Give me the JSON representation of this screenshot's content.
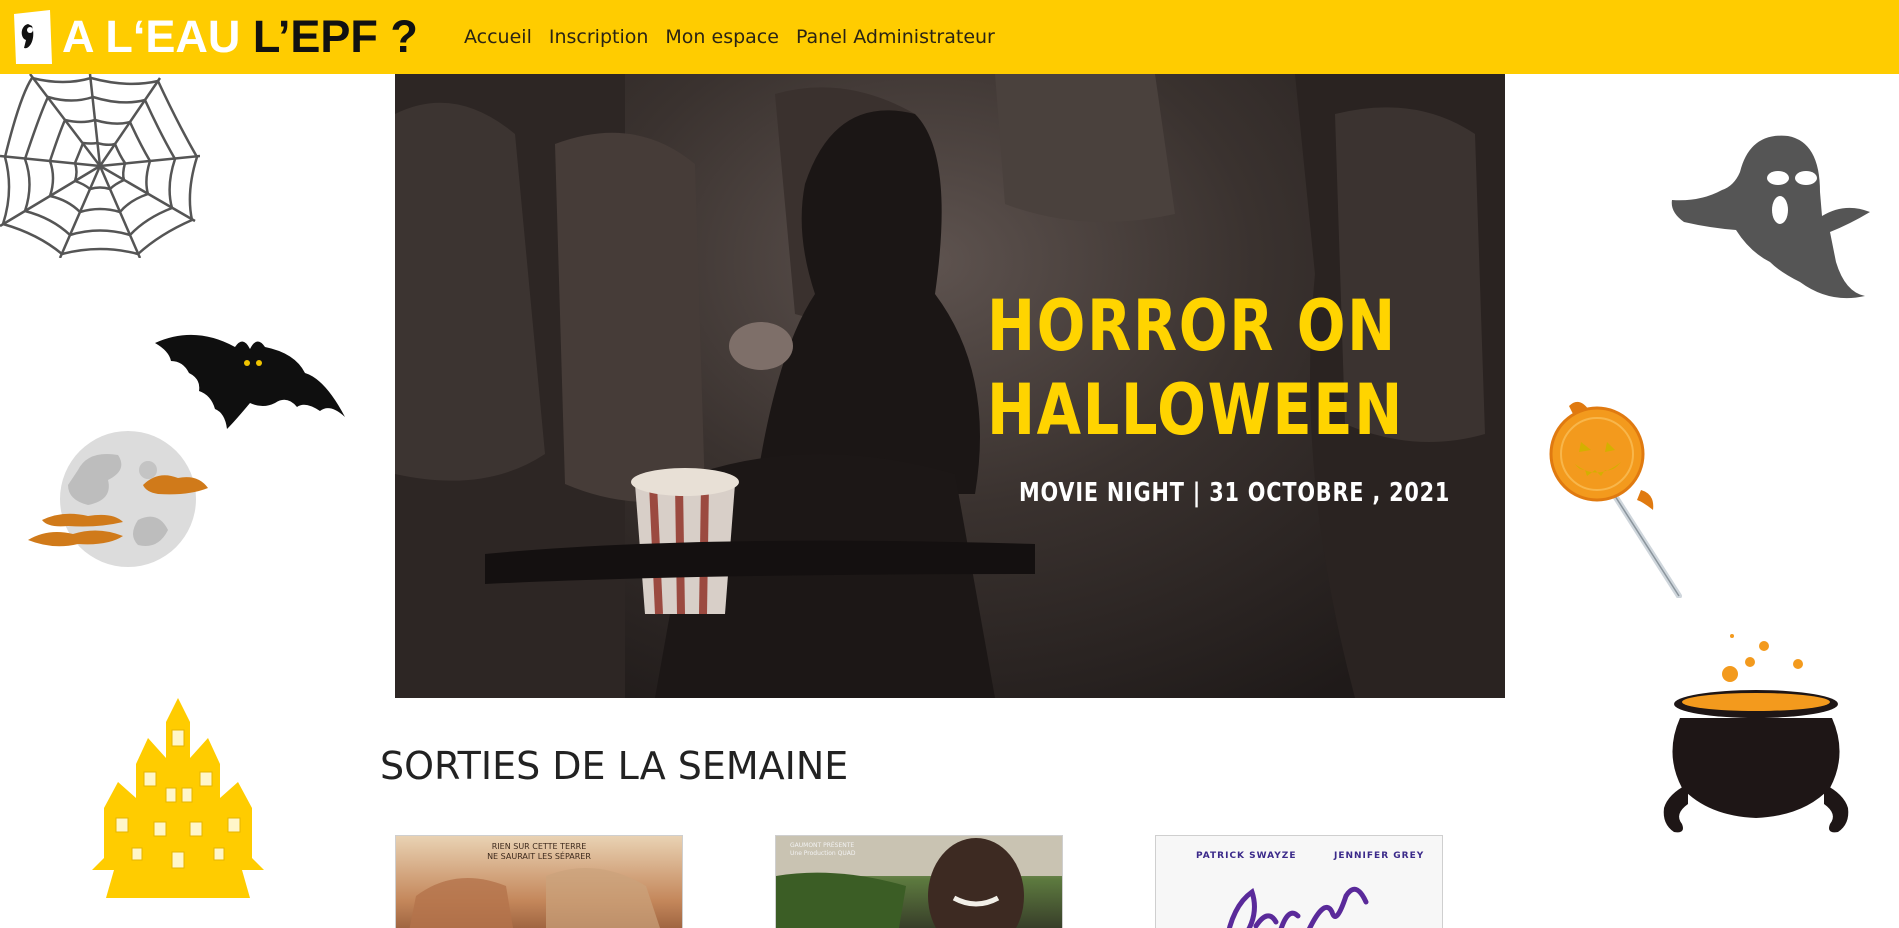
{
  "navbar": {
    "logo": {
      "part1": "A L‘EAU",
      "part2": "L’EPF ?"
    },
    "links": [
      "Accueil",
      "Inscription",
      "Mon espace",
      "Panel Administrateur"
    ]
  },
  "banner": {
    "title_line1": "HORROR ON",
    "title_line2": "HALLOWEEN",
    "subtitle": "MOVIE NIGHT | 31 OCTOBRE , 2021"
  },
  "section": {
    "title": "SORTIES DE LA SEMAINE"
  },
  "movies": [
    {
      "poster_text": "RIEN SUR CETTE TERRE\nNE SAURAIT LES SÉPARER"
    },
    {
      "poster_text": "GAUMONT PRÉSENTE\nUne Production QUAD"
    },
    {
      "actor_left": "PATRICK SWAYZE",
      "actor_right": "JENNIFER GREY",
      "title_partial": "Dirty Dancing"
    }
  ],
  "colors": {
    "navbar": "#ffcc00",
    "accent_yellow": "#ffd400",
    "banner_dark": "#2a2322"
  },
  "decorations": [
    "spider-web-icon",
    "bat-icon",
    "moon-icon",
    "haunted-house-icon",
    "ghost-icon",
    "lollipop-icon",
    "cauldron-icon"
  ]
}
